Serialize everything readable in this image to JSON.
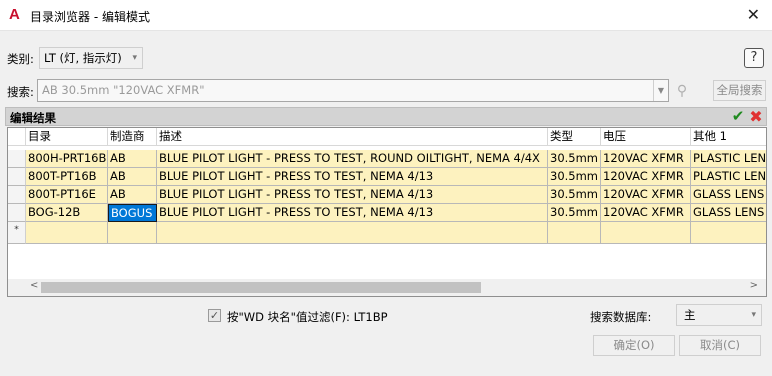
{
  "window": {
    "title": "目录浏览器 - 编辑模式",
    "app_icon": "A"
  },
  "category": {
    "label": "类别:",
    "value": "LT (灯, 指示灯)"
  },
  "search": {
    "label": "搜索:",
    "value": "AB 30.5mm \"120VAC XFMR\"",
    "global_button": "全局搜索"
  },
  "results": {
    "label": "编辑结果"
  },
  "table": {
    "columns": [
      "目录",
      "制造商",
      "描述",
      "类型",
      "电压",
      "其他 1"
    ],
    "rows": [
      {
        "catalog": "800H-PRT16B",
        "mfg": "AB",
        "desc": "BLUE PILOT LIGHT - PRESS TO TEST, ROUND OILTIGHT, NEMA 4/4X",
        "type": "30.5mm",
        "voltage": "120VAC XFMR",
        "misc": "PLASTIC LENS"
      },
      {
        "catalog": "800T-PT16B",
        "mfg": "AB",
        "desc": "BLUE PILOT LIGHT - PRESS TO TEST, NEMA 4/13",
        "type": "30.5mm",
        "voltage": "120VAC XFMR",
        "misc": "PLASTIC LENS"
      },
      {
        "catalog": "800T-PT16E",
        "mfg": "AB",
        "desc": "BLUE PILOT LIGHT - PRESS TO TEST, NEMA 4/13",
        "type": "30.5mm",
        "voltage": "120VAC XFMR",
        "misc": "GLASS LENS"
      },
      {
        "catalog": "BOG-12B",
        "mfg": "BOGUS",
        "desc": "BLUE PILOT LIGHT - PRESS TO TEST, NEMA 4/13",
        "type": "30.5mm",
        "voltage": "120VAC XFMR",
        "misc": "GLASS LENS"
      }
    ],
    "new_row_marker": "*"
  },
  "filter": {
    "label": "按\"WD 块名\"值过滤(F): LT1BP",
    "checked": true
  },
  "database": {
    "label": "搜索数据库:",
    "value": "主"
  },
  "buttons": {
    "ok": "确定(O)",
    "cancel": "取消(C)"
  },
  "colors": {
    "row_fill": "#fdf2bf",
    "selection": "#0078d7",
    "accept": "#1f8a1f",
    "reject": "#e03030"
  }
}
